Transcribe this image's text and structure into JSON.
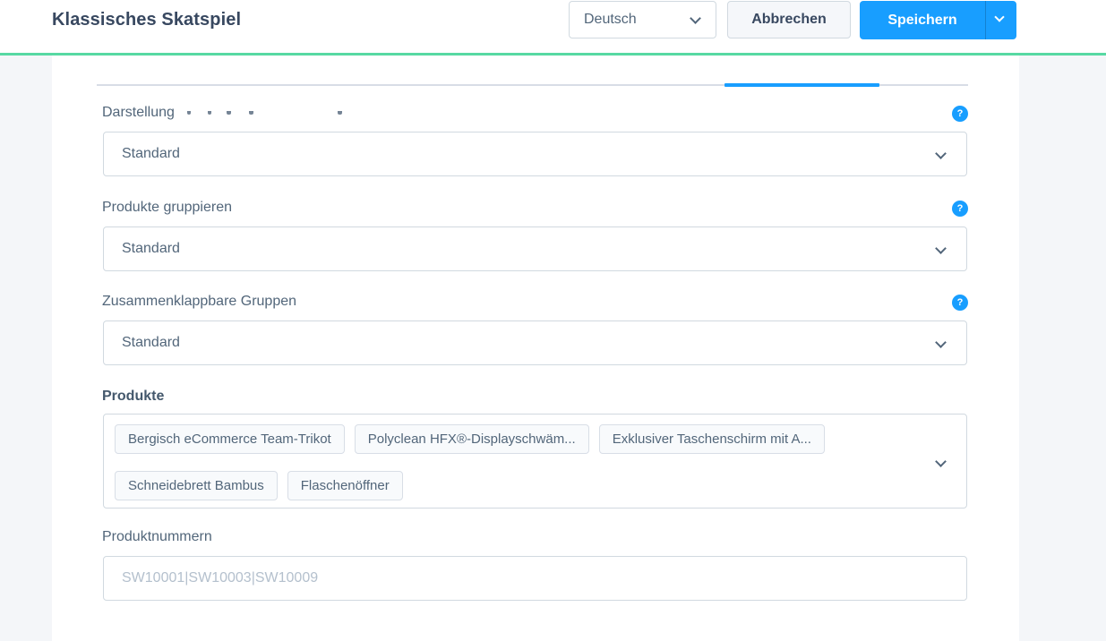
{
  "header": {
    "title": "Klassisches Skatspiel",
    "language_select": {
      "value": "Deutsch"
    },
    "cancel_label": "Abbrechen",
    "save_label": "Speichern"
  },
  "form": {
    "fields": [
      {
        "label": "Darstellung",
        "value": "Standard"
      },
      {
        "label": "Produkte gruppieren",
        "value": "Standard"
      },
      {
        "label": "Zusammenklappbare Gruppen",
        "value": "Standard"
      }
    ],
    "products": {
      "label": "Produkte",
      "tags": [
        "Bergisch eCommerce Team-Trikot",
        "Polyclean HFX®-Displayschwäm...",
        "Exklusiver Taschenschirm mit A...",
        "Schneidebrett Bambus",
        "Flaschenöffner"
      ]
    },
    "product_numbers": {
      "label": "Produktnummern",
      "value": "",
      "placeholder": "SW10001|SW10003|SW10009"
    }
  },
  "icons": {
    "help_glyph": "?",
    "chevron": "chevron-down"
  },
  "colors": {
    "accent_blue": "#189eff",
    "module_green": "#57d9a3",
    "border": "#d1d9e0",
    "text": "#52667a",
    "headline": "#384860",
    "page_background": "#f4f6f9"
  }
}
